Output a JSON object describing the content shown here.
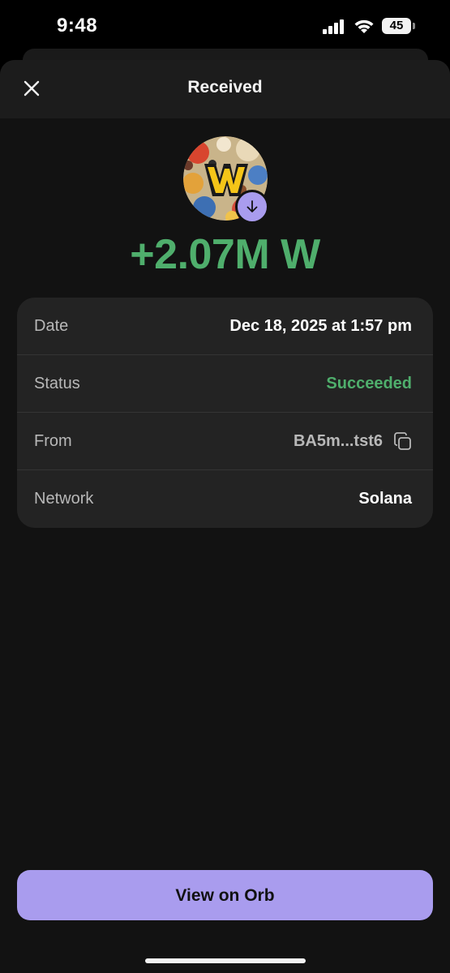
{
  "status_bar": {
    "time": "9:48",
    "battery": "45"
  },
  "header": {
    "title": "Received",
    "close_icon": "close-icon"
  },
  "token": {
    "letter": "W",
    "amount": "+2.07M W",
    "badge_icon": "arrow-down-icon"
  },
  "details": {
    "rows": [
      {
        "label": "Date",
        "value": "Dec 18, 2025 at 1:57 pm"
      },
      {
        "label": "Status",
        "value": "Succeeded"
      },
      {
        "label": "From",
        "value": "BA5m...tst6"
      },
      {
        "label": "Network",
        "value": "Solana"
      }
    ]
  },
  "actions": {
    "view_button": "View on Orb"
  },
  "colors": {
    "background": "#121212",
    "card": "#232323",
    "accent": "#a99cee",
    "success": "#4fae6c"
  }
}
